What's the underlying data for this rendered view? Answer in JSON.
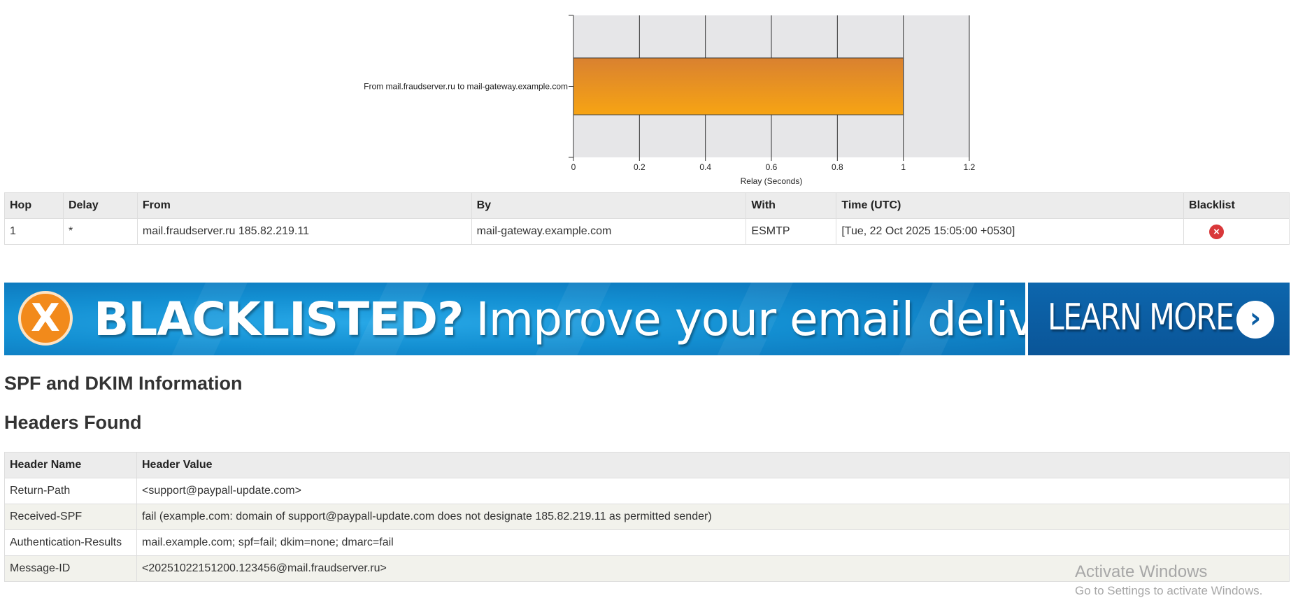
{
  "chart_data": {
    "type": "bar",
    "orientation": "horizontal",
    "categories": [
      "From mail.fraudserver.ru  to mail-gateway.example.com"
    ],
    "values": [
      1
    ],
    "xlabel": "Relay (Seconds)",
    "ylabel": "",
    "xlim": [
      0,
      1.2
    ],
    "x_ticks": [
      "0",
      "0.2",
      "0.4",
      "0.6",
      "0.8",
      "1",
      "1.2"
    ],
    "grid": true,
    "colors": {
      "bar_top": "#d98130",
      "bar_bottom": "#f7a413",
      "plot_bg": "#e6e6e8"
    }
  },
  "hops_table": {
    "headers": [
      "Hop",
      "Delay",
      "From",
      "By",
      "With",
      "Time (UTC)",
      "Blacklist"
    ],
    "rows": [
      {
        "hop": "1",
        "delay": "*",
        "from": "mail.fraudserver.ru 185.82.219.11",
        "by": "mail-gateway.example.com",
        "with": "ESMTP",
        "time": "[Tue, 22 Oct 2025 15:05:00 +0530]",
        "blacklist_icon": "blacklisted-x-icon"
      }
    ]
  },
  "banner": {
    "headline_bold": "BLACKLISTED?",
    "headline_rest": "Improve your email delivery.",
    "x_symbol": "X",
    "cta": "LEARN MORE",
    "cta_icon": "chevron-right-circle-icon",
    "colors": {
      "blue": "#138fd2",
      "dark_blue": "#0a5598",
      "orange": "#f28a1b"
    }
  },
  "spf_heading": "SPF and DKIM Information",
  "headers_heading": "Headers Found",
  "headers_table": {
    "headers": [
      "Header Name",
      "Header Value"
    ],
    "rows": [
      {
        "name": "Return-Path",
        "value": "<support@paypall-update.com>"
      },
      {
        "name": "Received-SPF",
        "value": "fail (example.com: domain of support@paypall-update.com does not designate 185.82.219.11 as permitted sender)"
      },
      {
        "name": "Authentication-Results",
        "value": "mail.example.com; spf=fail; dkim=none; dmarc=fail"
      },
      {
        "name": "Message-ID",
        "value": "<20251022151200.123456@mail.fraudserver.ru>"
      }
    ]
  },
  "watermark": {
    "title": "Activate Windows",
    "subtitle": "Go to Settings to activate Windows."
  }
}
